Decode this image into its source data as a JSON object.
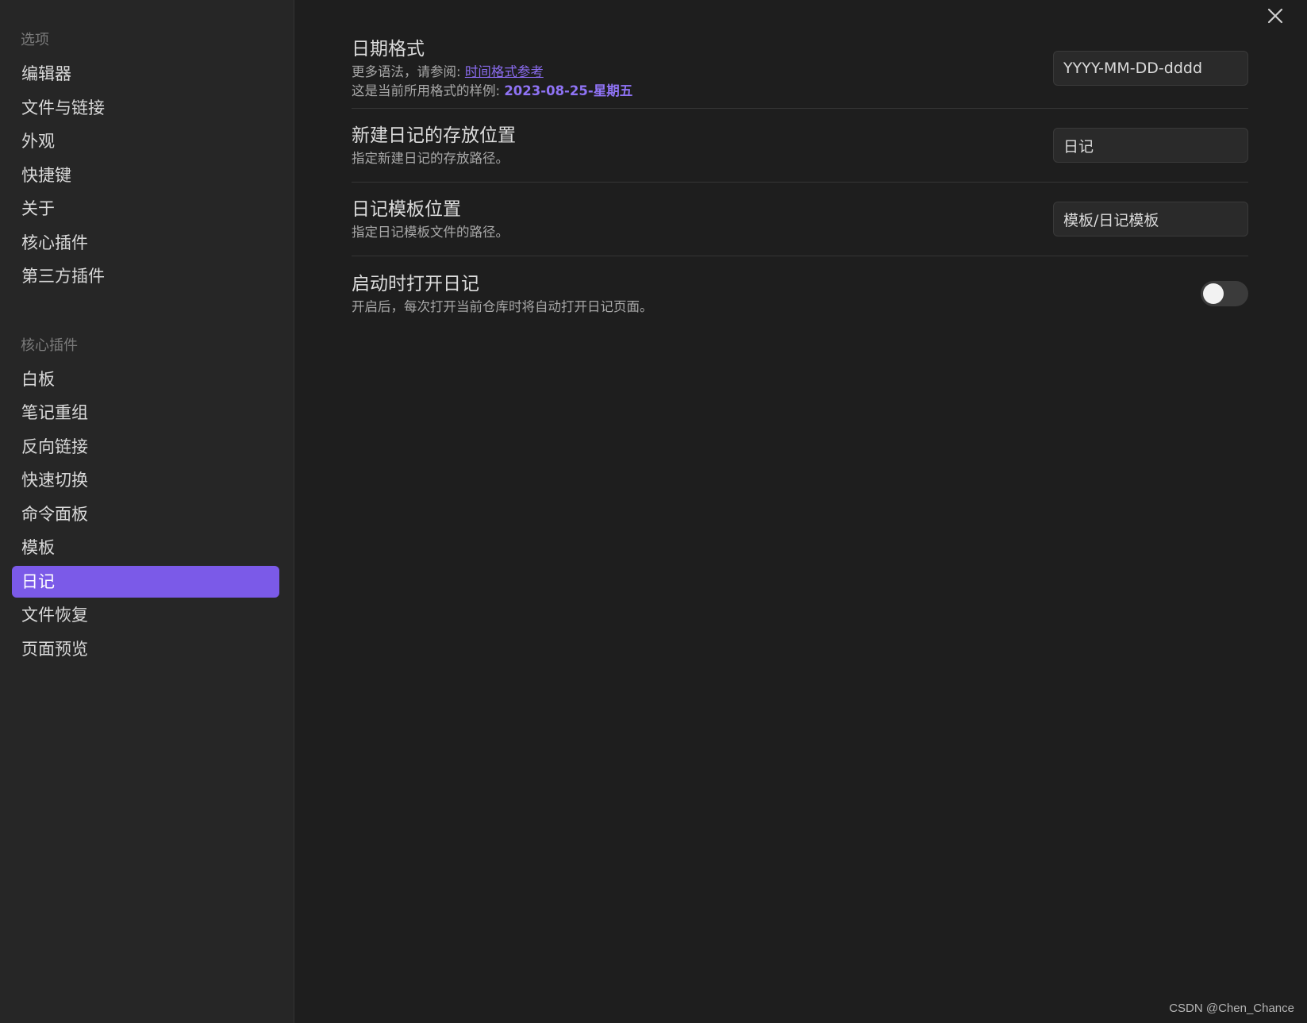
{
  "sidebar": {
    "options_heading": "选项",
    "options_items": [
      {
        "label": "编辑器"
      },
      {
        "label": "文件与链接"
      },
      {
        "label": "外观"
      },
      {
        "label": "快捷键"
      },
      {
        "label": "关于"
      },
      {
        "label": "核心插件"
      },
      {
        "label": "第三方插件"
      }
    ],
    "core_heading": "核心插件",
    "core_items": [
      {
        "label": "白板"
      },
      {
        "label": "笔记重组"
      },
      {
        "label": "反向链接"
      },
      {
        "label": "快速切换"
      },
      {
        "label": "命令面板"
      },
      {
        "label": "模板"
      },
      {
        "label": "日记",
        "active": true
      },
      {
        "label": "文件恢复"
      },
      {
        "label": "页面预览"
      }
    ]
  },
  "settings": {
    "date_format": {
      "name": "日期格式",
      "desc_prefix": "更多语法，请参阅: ",
      "desc_link": "时间格式参考",
      "example_prefix": "这是当前所用格式的样例: ",
      "example_value": "2023-08-25-星期五",
      "value": "YYYY-MM-DD-dddd"
    },
    "new_note_location": {
      "name": "新建日记的存放位置",
      "desc": "指定新建日记的存放路径。",
      "value": "日记"
    },
    "template_location": {
      "name": "日记模板位置",
      "desc": "指定日记模板文件的路径。",
      "value": "模板/日记模板"
    },
    "open_on_startup": {
      "name": "启动时打开日记",
      "desc": "开启后，每次打开当前仓库时将自动打开日记页面。",
      "enabled": false
    }
  },
  "watermark": "CSDN @Chen_Chance",
  "colors": {
    "accent": "#7b5ae8",
    "background": "#1e1e1e",
    "sidebar_background": "#262626"
  },
  "icons": {
    "close": "close-icon"
  }
}
